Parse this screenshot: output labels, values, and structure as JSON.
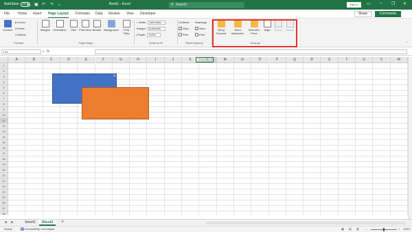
{
  "titlebar": {
    "autosave": "AutoSave",
    "toggle": "Off",
    "title": "Book1 - Excel",
    "search_placeholder": "Search",
    "signin": "Sign in"
  },
  "menu": {
    "tabs": [
      "File",
      "Home",
      "Insert",
      "Page Layout",
      "Formulas",
      "Data",
      "Review",
      "View",
      "Developer"
    ],
    "active": "Page Layout",
    "share": "Share",
    "comments": "Comments"
  },
  "ribbon": {
    "themes": {
      "themes": "Themes",
      "colors": "Colors",
      "fonts": "Fonts",
      "effects": "Effects",
      "label": "Themes"
    },
    "page_setup": {
      "margins": "Margins",
      "orientation": "Orientation",
      "size": "Size",
      "print_area": "Print Area",
      "breaks": "Breaks",
      "background": "Background",
      "print_titles": "Print Titles",
      "label": "Page Setup"
    },
    "scale": {
      "width": "Width:",
      "width_val": "Automatic",
      "height": "Height:",
      "height_val": "Automatic",
      "scale": "Scale:",
      "scale_val": "100%",
      "label": "Scale to Fit"
    },
    "sheet_options": {
      "gridlines": "Gridlines",
      "headings": "Headings",
      "view": "View",
      "print": "Print",
      "label": "Sheet Options"
    },
    "arrange": {
      "bring_forward": "Bring Forward",
      "send_backward": "Send Backward",
      "selection_pane": "Selection Pane",
      "align": "Align",
      "group": "Group",
      "rotate": "Rotate",
      "label": "Arrange"
    }
  },
  "formula": {
    "namebox": "L11",
    "fx": "fx"
  },
  "columns": [
    "A",
    "B",
    "C",
    "D",
    "E",
    "F",
    "G",
    "H",
    "I",
    "J",
    "K",
    "L",
    "M",
    "N",
    "O",
    "P",
    "Q",
    "R",
    "S",
    "T",
    "U",
    "V",
    "W"
  ],
  "rows": [
    "1",
    "2",
    "3",
    "4",
    "5",
    "6",
    "7",
    "8",
    "9",
    "10",
    "11",
    "12",
    "13",
    "14",
    "15",
    "16",
    "17",
    "18",
    "19",
    "20",
    "21",
    "22",
    "23",
    "24",
    "25",
    "26",
    "27",
    "28"
  ],
  "sheets": {
    "tabs": [
      "Sheet1",
      "Sheet2"
    ],
    "active": "Sheet2",
    "add": "+"
  },
  "status": {
    "ready": "Ready",
    "accessibility": "Accessibility: Investigate",
    "zoom": "100%"
  },
  "colors": {
    "excel_green": "#217346",
    "shape_blue": "#4472c4",
    "shape_orange": "#ed7d31",
    "highlight": "#e3322c"
  }
}
